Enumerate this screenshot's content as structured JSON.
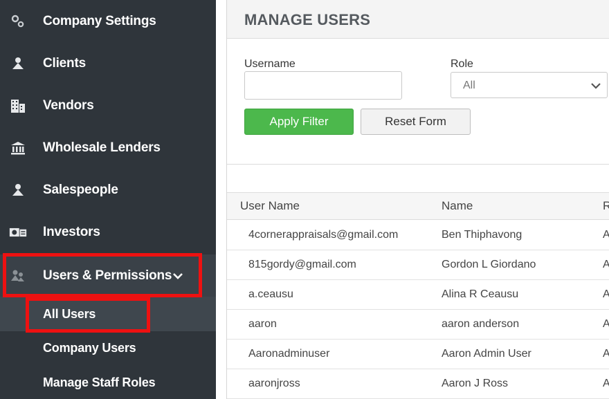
{
  "sidebar": {
    "items": [
      {
        "label": "Company Settings",
        "icon": "gears-icon"
      },
      {
        "label": "Clients",
        "icon": "person-icon"
      },
      {
        "label": "Vendors",
        "icon": "building-icon"
      },
      {
        "label": "Wholesale Lenders",
        "icon": "bank-icon"
      },
      {
        "label": "Salespeople",
        "icon": "person-icon"
      },
      {
        "label": "Investors",
        "icon": "money-icon"
      },
      {
        "label": "Users & Permissions",
        "icon": "users-icon"
      }
    ],
    "subitems": [
      {
        "label": "All Users"
      },
      {
        "label": "Company Users"
      },
      {
        "label": "Manage Staff Roles"
      }
    ],
    "highlight_color": "#ee1111"
  },
  "page": {
    "title": "MANAGE USERS"
  },
  "filters": {
    "username_label": "Username",
    "username_value": "",
    "role_label": "Role",
    "role_value": "All",
    "apply_label": "Apply Filter",
    "reset_label": "Reset Form"
  },
  "table": {
    "headers": [
      "User Name",
      "Name",
      "R"
    ],
    "rows": [
      [
        "4cornerappraisals@gmail.com",
        "Ben Thiphavong",
        "A"
      ],
      [
        "815gordy@gmail.com",
        "Gordon L Giordano",
        "A"
      ],
      [
        "a.ceausu",
        "Alina R Ceausu",
        "A"
      ],
      [
        "aaron",
        "aaron anderson",
        "A"
      ],
      [
        "Aaronadminuser",
        "Aaron Admin User",
        "A"
      ],
      [
        "aaronjross",
        "Aaron J Ross",
        "A"
      ]
    ]
  },
  "colors": {
    "sidebar_bg": "#2f353b",
    "apply_button": "#4cb84c"
  }
}
